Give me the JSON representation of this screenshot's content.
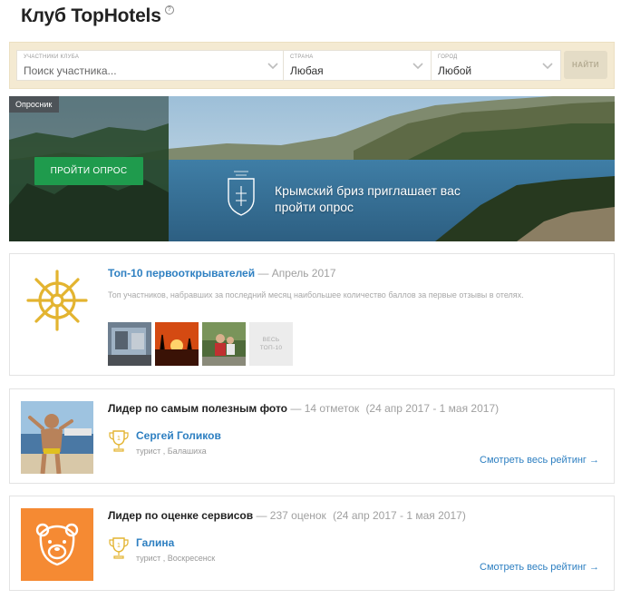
{
  "page": {
    "title": "Клуб TopHotels",
    "help_icon": "?"
  },
  "search": {
    "member_label": "участники клуба",
    "member_placeholder": "Поиск участника...",
    "country_label": "страна",
    "country_value": "Любая",
    "city_label": "город",
    "city_value": "Любой",
    "find_button": "НАЙТИ"
  },
  "banner": {
    "tag": "Опросник",
    "button": "ПРОЙТИ ОПРОС",
    "text": "Крымский бриз приглашает вас пройти опрос",
    "logo_caption": "Крымский бриз",
    "logo_icon": "coat-of-arms-icon"
  },
  "top10": {
    "title": "Топ-10 первооткрывателей",
    "meta": "— Апрель 2017",
    "description": "Топ участников, набравших за последний месяц наибольшее количество баллов за первые отзывы в отелях.",
    "all_label_line1": "ВЕСЬ",
    "all_label_line2": "ТОП-10",
    "icon": "ship-wheel-icon"
  },
  "leader_photo": {
    "title": "Лидер по самым полезным фото",
    "count": "— 14 отметок",
    "dates": "(24 апр 2017 - 1 мая 2017)",
    "trophy_rank": "1",
    "user_name": "Сергей  Голиков",
    "user_meta": "турист , Балашиха",
    "rating_link": "Смотреть весь рейтинг →"
  },
  "leader_service": {
    "title": "Лидер по оценке сервисов",
    "count": "— 237 оценок",
    "dates": "(24 апр 2017 - 1 мая 2017)",
    "trophy_rank": "1",
    "user_name": "Галина",
    "user_meta": "турист , Воскресенск",
    "rating_link": "Смотреть весь рейтинг →",
    "avatar_icon": "bear-avatar-icon"
  },
  "colors": {
    "accent_blue": "#2d7fc1",
    "gold": "#e3b430",
    "green_button": "#1f9b4d",
    "orange_avatar": "#f58a33",
    "search_bg": "#f4ead2"
  }
}
